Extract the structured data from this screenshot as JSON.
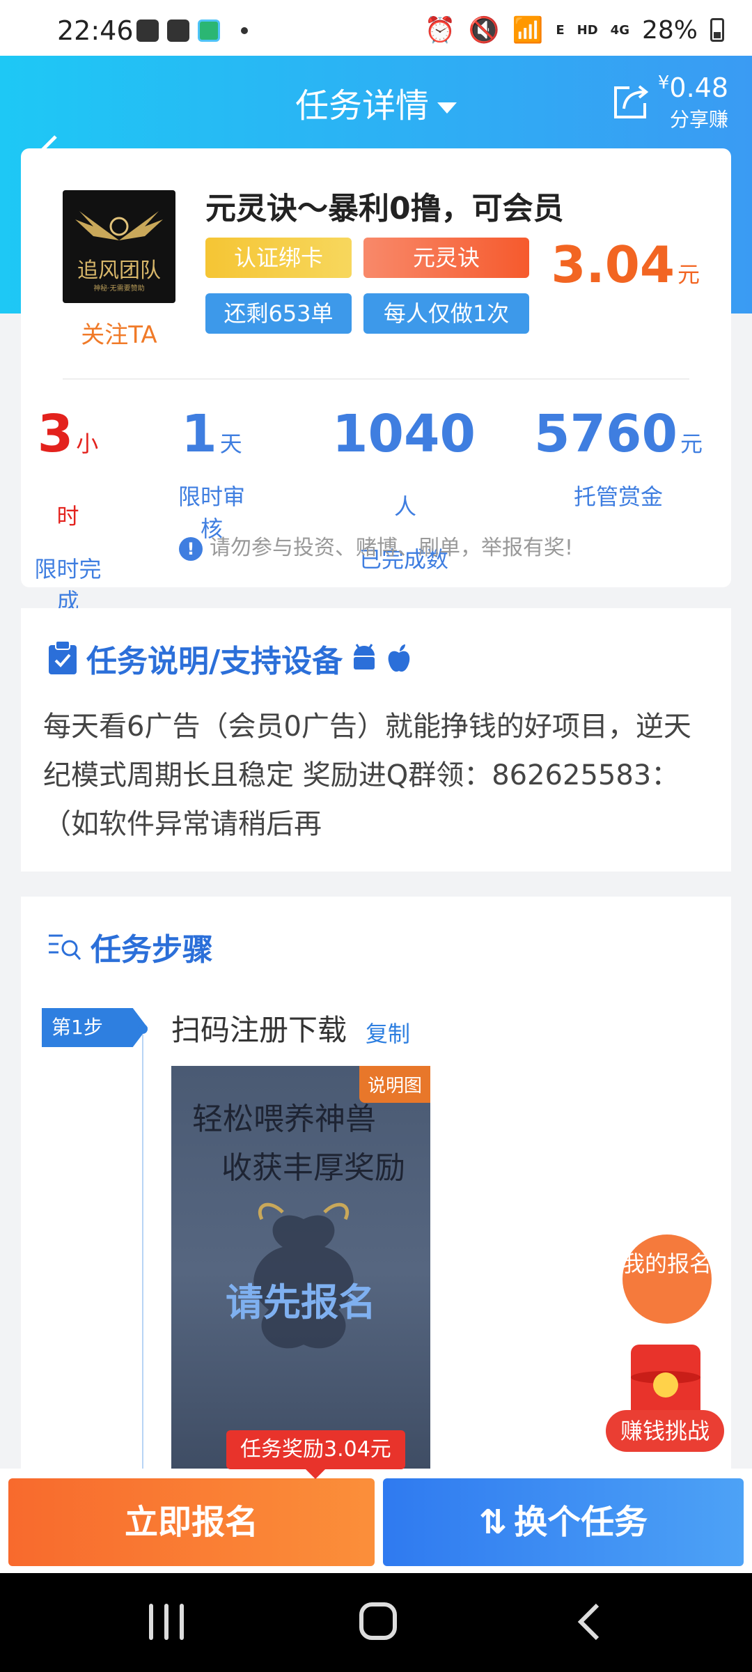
{
  "status_bar": {
    "time": "22:46",
    "network": "4G",
    "hd": "HD",
    "e_label": "E",
    "battery": "28%"
  },
  "header": {
    "title": "任务详情",
    "share_amount_currency": "¥",
    "share_amount": "0.48",
    "share_label": "分享赚"
  },
  "task": {
    "logo_text": "追风团队",
    "logo_sub": "神秘·无需要赞助",
    "follow_label": "关注TA",
    "title": "元灵诀～暴利0撸，可会员",
    "tags": [
      "认证绑卡",
      "元灵诀",
      "还剩653单",
      "每人仅做1次"
    ],
    "price": "3.04",
    "price_unit": "元",
    "stats": [
      {
        "value": "3",
        "unit": "小时",
        "label": "限时完成"
      },
      {
        "value": "1",
        "unit": "天",
        "label": "限时审核"
      },
      {
        "value": "1040",
        "unit": "人",
        "label": "已完成数"
      },
      {
        "value": "5760",
        "unit": "元",
        "label": "托管赏金"
      }
    ],
    "warning": "请勿参与投资、赌博、刷单，举报有奖!"
  },
  "description": {
    "title": "任务说明/支持设备",
    "text": "每天看6广告（会员0广告）就能挣钱的好项目，逆天纪模式周期长且稳定 奖励进Q群领：862625583：（如软件异常请稍后再"
  },
  "steps": {
    "title": "任务步骤",
    "step1_badge": "第1步",
    "step1_text": "扫码注册下载",
    "step1_copy": "复制",
    "image_line1": "轻松喂养神兽",
    "image_line2": "收获丰厚奖励",
    "image_overlay": "请先报名",
    "image_badge": "说明图"
  },
  "reward_tip": "任务奖励3.04元",
  "floating": {
    "my_signup": "我的报名",
    "earn_challenge": "赚钱挑战"
  },
  "bottom": {
    "signup": "立即报名",
    "switch": "换个任务"
  },
  "colors": {
    "header_gradient_start": "#1ec8f5",
    "header_gradient_end": "#3a9bf3",
    "price_orange": "#f26522",
    "stat_blue": "#3f7ee0",
    "stat_red": "#e3221d"
  }
}
